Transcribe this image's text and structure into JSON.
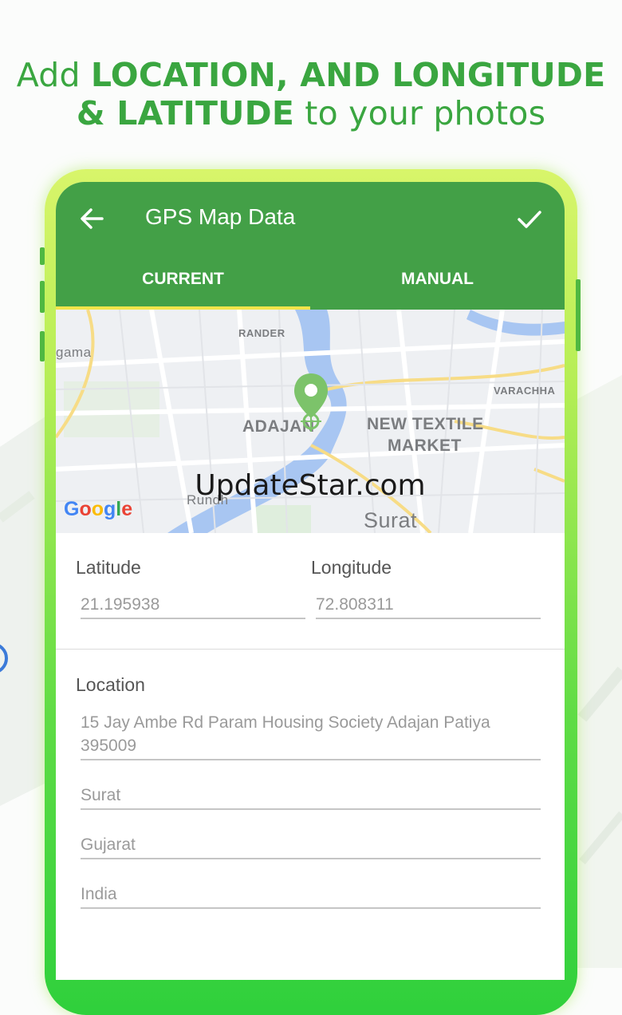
{
  "headline": {
    "part1": "Add ",
    "bold1": "LOCATION, AND LONGITUDE",
    "bold2": "& LATITUDE",
    "part2": " to your photos"
  },
  "appbar": {
    "title": "GPS Map Data",
    "back_icon": "arrow-left-icon",
    "confirm_icon": "check-icon"
  },
  "tabs": [
    {
      "label": "CURRENT",
      "active": true
    },
    {
      "label": "MANUAL",
      "active": false
    }
  ],
  "map": {
    "labels": {
      "rander": "RANDER",
      "gama": "gama",
      "varachha": "VARACHHA",
      "adajan": "ADAJAN",
      "textile1": "NEW TEXTILE",
      "textile2": "MARKET",
      "rundh": "Rundh",
      "surat": "Surat"
    },
    "google": [
      "G",
      "o",
      "o",
      "g",
      "l",
      "e"
    ],
    "marker_icon": "map-pin-icon"
  },
  "watermark": "UpdateStar.com",
  "fields": {
    "latitude_label": "Latitude",
    "latitude_value": "21.195938",
    "longitude_label": "Longitude",
    "longitude_value": "72.808311",
    "location_label": "Location",
    "address_line1": "15 Jay Ambe Rd Param Housing Society Adajan Patiya",
    "address_line2": "395009",
    "city": "Surat",
    "state": "Gujarat",
    "country": "India"
  },
  "colors": {
    "brand_green": "#43a047",
    "headline_green": "#3aa640",
    "tab_indicator": "#f2e44a",
    "marker_green": "#7cc36a"
  }
}
